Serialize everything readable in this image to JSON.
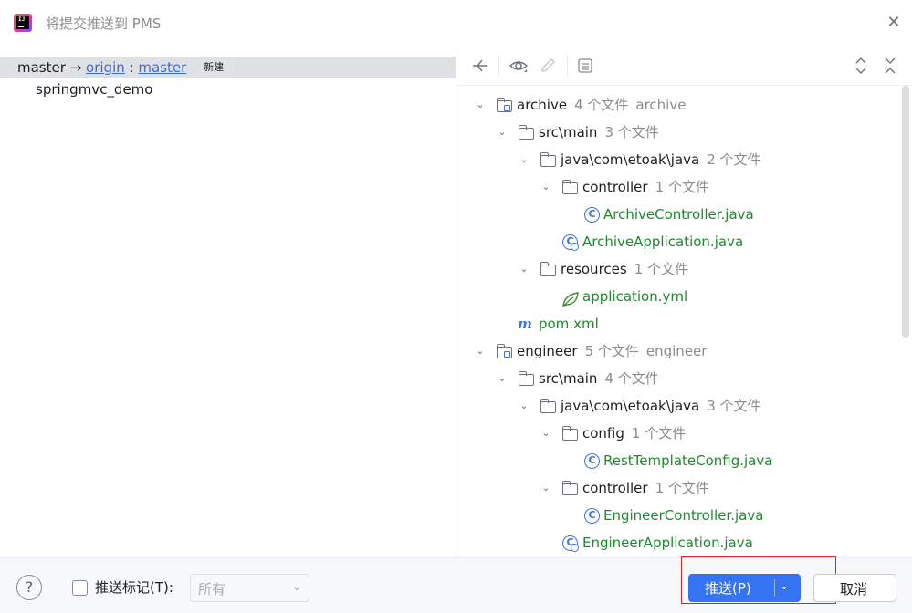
{
  "window": {
    "title": "将提交推送到 PMS",
    "app_icon": "intellij-idea-icon",
    "close_icon": "close-icon"
  },
  "left_panel": {
    "branch": {
      "local": "master",
      "arrow": "→",
      "remote": "origin",
      "separator": ":",
      "remote_branch": "master",
      "badge": "新建"
    },
    "project": "springmvc_demo"
  },
  "toolbar": {
    "icons": [
      "collapse-icon",
      "eye-icon",
      "pencil-icon",
      "diff-icon",
      "expand-all-icon",
      "collapse-all-icon"
    ]
  },
  "tree": [
    {
      "name": "archive",
      "count": "4 个文件",
      "extra": "archive",
      "kind": "module"
    },
    {
      "name": "src\\main",
      "count": "3 个文件",
      "kind": "folder"
    },
    {
      "name": "java\\com\\etoak\\java",
      "count": "2 个文件",
      "kind": "folder"
    },
    {
      "name": "controller",
      "count": "1 个文件",
      "kind": "folder"
    },
    {
      "name": "ArchiveController.java",
      "kind": "class"
    },
    {
      "name": "ArchiveApplication.java",
      "kind": "app"
    },
    {
      "name": "resources",
      "count": "1 个文件",
      "kind": "folder"
    },
    {
      "name": "application.yml",
      "kind": "yml"
    },
    {
      "name": "pom.xml",
      "kind": "maven"
    },
    {
      "name": "engineer",
      "count": "5 个文件",
      "extra": "engineer",
      "kind": "module"
    },
    {
      "name": "src\\main",
      "count": "4 个文件",
      "kind": "folder"
    },
    {
      "name": "java\\com\\etoak\\java",
      "count": "3 个文件",
      "kind": "folder"
    },
    {
      "name": "config",
      "count": "1 个文件",
      "kind": "folder"
    },
    {
      "name": "RestTemplateConfig.java",
      "kind": "class"
    },
    {
      "name": "controller",
      "count": "1 个文件",
      "kind": "folder"
    },
    {
      "name": "EngineerController.java",
      "kind": "class"
    },
    {
      "name": "EngineerApplication.java",
      "kind": "app"
    }
  ],
  "bottom": {
    "help": "?",
    "push_tags_label": "推送标记(T):",
    "tags_select_value": "所有",
    "push_button": "推送(P)",
    "cancel_button": "取消"
  },
  "colors": {
    "accent": "#3574f0",
    "file_added": "#1e8a2e",
    "highlight_box": "#e02020"
  }
}
